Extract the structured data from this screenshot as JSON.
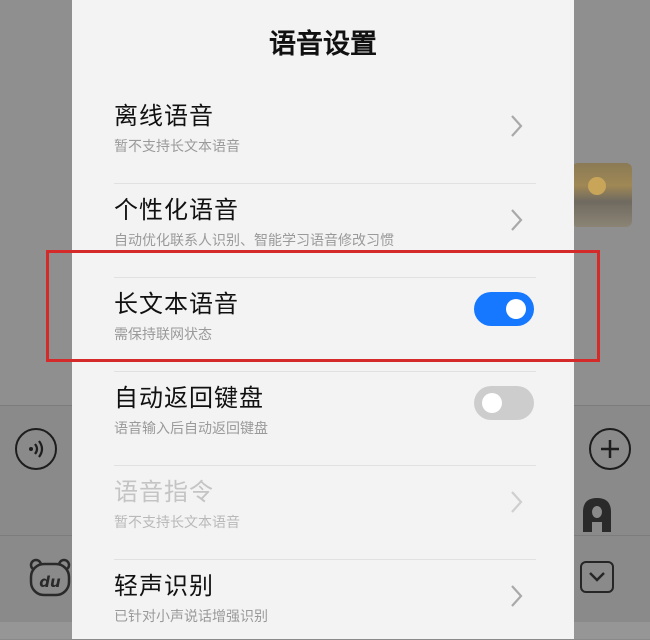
{
  "dialog": {
    "title": "语音设置"
  },
  "settings": [
    {
      "label": "离线语音",
      "subtitle": "暂不支持长文本语音",
      "control": "chevron",
      "enabled": true
    },
    {
      "label": "个性化语音",
      "subtitle": "自动优化联系人识别、智能学习语音修改习惯",
      "control": "chevron",
      "enabled": true
    },
    {
      "label": "长文本语音",
      "subtitle": "需保持联网状态",
      "control": "toggle",
      "toggle_on": true,
      "enabled": true
    },
    {
      "label": "自动返回键盘",
      "subtitle": "语音输入后自动返回键盘",
      "control": "toggle",
      "toggle_on": false,
      "enabled": true
    },
    {
      "label": "语音指令",
      "subtitle": "暂不支持长文本语音",
      "control": "chevron",
      "enabled": false
    },
    {
      "label": "轻声识别",
      "subtitle": "已针对小声说话增强识别",
      "control": "chevron",
      "enabled": true
    }
  ],
  "background": {
    "du_logo": "du",
    "icons": [
      "voice-wave-icon",
      "plus-icon",
      "font-a-icon",
      "du-bear-logo",
      "collapse-keyboard-icon"
    ]
  },
  "colors": {
    "toggle_on": "#1677ff",
    "toggle_off": "#cdcdcd",
    "highlight": "#d52a2a"
  }
}
